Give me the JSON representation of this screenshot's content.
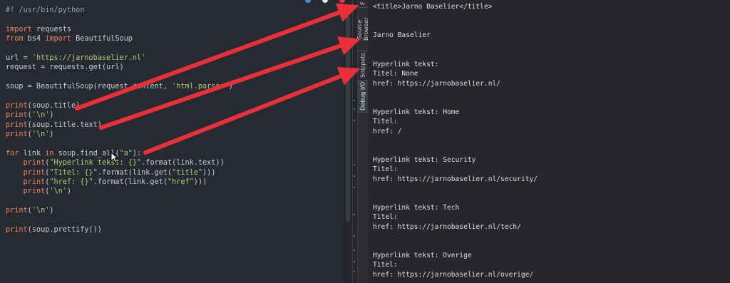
{
  "editor": {
    "lines": [
      [
        {
          "t": "#! /usr/bin/python",
          "c": "cmt"
        }
      ],
      [],
      [
        {
          "t": "import",
          "c": "kw"
        },
        {
          "t": " requests"
        }
      ],
      [
        {
          "t": "from",
          "c": "kw"
        },
        {
          "t": " bs4 "
        },
        {
          "t": "import",
          "c": "kw"
        },
        {
          "t": " BeautifulSoup"
        }
      ],
      [],
      [
        {
          "t": "url = "
        },
        {
          "t": "'https://jarnobaselier.nl'",
          "c": "str"
        }
      ],
      [
        {
          "t": "request = requests.get(url)"
        }
      ],
      [],
      [
        {
          "t": "soup = BeautifulSoup(request.content, "
        },
        {
          "t": "'html.parser'",
          "c": "str"
        },
        {
          "t": ")"
        }
      ],
      [],
      [
        {
          "t": "print",
          "c": "kw"
        },
        {
          "t": "(soup.title)"
        }
      ],
      [
        {
          "t": "print",
          "c": "kw"
        },
        {
          "t": "("
        },
        {
          "t": "'\\n'",
          "c": "str"
        },
        {
          "t": ")"
        }
      ],
      [
        {
          "t": "print",
          "c": "kw"
        },
        {
          "t": "(soup.title.text)"
        }
      ],
      [
        {
          "t": "print",
          "c": "kw"
        },
        {
          "t": "("
        },
        {
          "t": "'\\n'",
          "c": "str"
        },
        {
          "t": ")"
        }
      ],
      [],
      [
        {
          "t": "for",
          "c": "kw"
        },
        {
          "t": " link "
        },
        {
          "t": "in",
          "c": "kw"
        },
        {
          "t": " soup.find_all("
        },
        {
          "t": "\"a\"",
          "c": "str"
        },
        {
          "t": "):"
        }
      ],
      [
        {
          "t": "    "
        },
        {
          "t": "print",
          "c": "kw"
        },
        {
          "t": "("
        },
        {
          "t": "\"Hyperlink tekst: {}\"",
          "c": "str"
        },
        {
          "t": ".format(link.text))"
        }
      ],
      [
        {
          "t": "    "
        },
        {
          "t": "print",
          "c": "kw"
        },
        {
          "t": "("
        },
        {
          "t": "\"Titel: {}\"",
          "c": "str"
        },
        {
          "t": ".format(link.get("
        },
        {
          "t": "\"title\"",
          "c": "str"
        },
        {
          "t": ")))"
        }
      ],
      [
        {
          "t": "    "
        },
        {
          "t": "print",
          "c": "kw"
        },
        {
          "t": "("
        },
        {
          "t": "\"href: {}\"",
          "c": "str"
        },
        {
          "t": ".format(link.get("
        },
        {
          "t": "\"href\"",
          "c": "str"
        },
        {
          "t": ")))"
        }
      ],
      [
        {
          "t": "    "
        },
        {
          "t": "print",
          "c": "kw"
        },
        {
          "t": "("
        },
        {
          "t": "'\\n'",
          "c": "str"
        },
        {
          "t": ")"
        }
      ],
      [],
      [
        {
          "t": "print",
          "c": "kw"
        },
        {
          "t": "("
        },
        {
          "t": "'\\n'",
          "c": "str"
        },
        {
          "t": ")"
        }
      ],
      [],
      [
        {
          "t": "print",
          "c": "kw"
        },
        {
          "t": "(soup.prettify())"
        }
      ]
    ]
  },
  "side_tabs": {
    "source_browser": "Source Browser",
    "snippets": "Snippets",
    "debug_io": "Debug I/O",
    "top_partial": "F"
  },
  "output": {
    "title_tag": "<title>Jarno Baselier</title>",
    "title_text": "Jarno Baselier",
    "entries": [
      {
        "tekst": "Hyperlink tekst:",
        "titel": "Titel: None",
        "href": "href: https://jarnobaselier.nl/"
      },
      {
        "tekst": "Hyperlink tekst: Home",
        "titel": "Titel:",
        "href": "href: /"
      },
      {
        "tekst": "Hyperlink tekst: Security",
        "titel": "Titel:",
        "href": "href: https://jarnobaselier.nl/security/"
      },
      {
        "tekst": "Hyperlink tekst: Tech",
        "titel": "Titel:",
        "href": "href: https://jarnobaselier.nl/tech/"
      },
      {
        "tekst": "Hyperlink tekst: Overige",
        "titel": "Titel:",
        "href": "href: https://jarnobaselier.nl/overige/"
      }
    ]
  },
  "colors": {
    "keyword": "#e98560",
    "string": "#a6d07a",
    "comment": "#9aa0aa",
    "arrow": "#e8303a"
  },
  "icons": [
    "bullet-icon-blue",
    "bullet-icon-white",
    "bullet-icon-red",
    "mouse-pointer-icon"
  ]
}
